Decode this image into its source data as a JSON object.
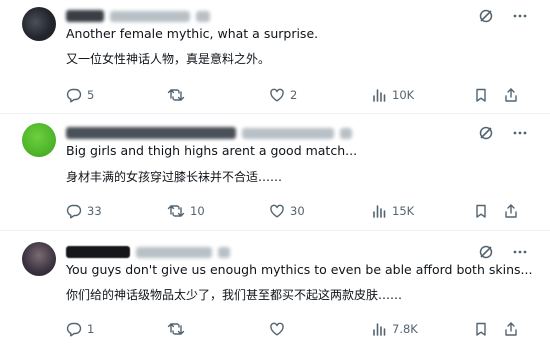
{
  "replies": [
    {
      "text_en": "Another female mythic, what a surprise.",
      "text_zh": "又一位女性神话人物，真是意料之外。",
      "stats": {
        "replies": "5",
        "reposts": "",
        "likes": "2",
        "views": "10K"
      }
    },
    {
      "text_en": "Big girls and thigh highs arent a good match...",
      "text_zh": "身材丰满的女孩穿过膝长袜并不合适……",
      "stats": {
        "replies": "33",
        "reposts": "10",
        "likes": "30",
        "views": "15K"
      }
    },
    {
      "text_en": "You guys don't give us enough mythics to even be able afford both skins...",
      "text_zh": "你们给的神话级物品太少了，我们甚至都买不起这两款皮肤……",
      "stats": {
        "replies": "1",
        "reposts": "",
        "likes": "",
        "views": "7.8K"
      }
    }
  ],
  "icons": [
    "grok-icon",
    "more-icon",
    "reply-icon",
    "repost-icon",
    "like-icon",
    "views-icon",
    "bookmark-icon",
    "share-icon"
  ],
  "colors": {
    "text": "#0f1419",
    "muted": "#536471",
    "divider": "#eff3f4"
  }
}
